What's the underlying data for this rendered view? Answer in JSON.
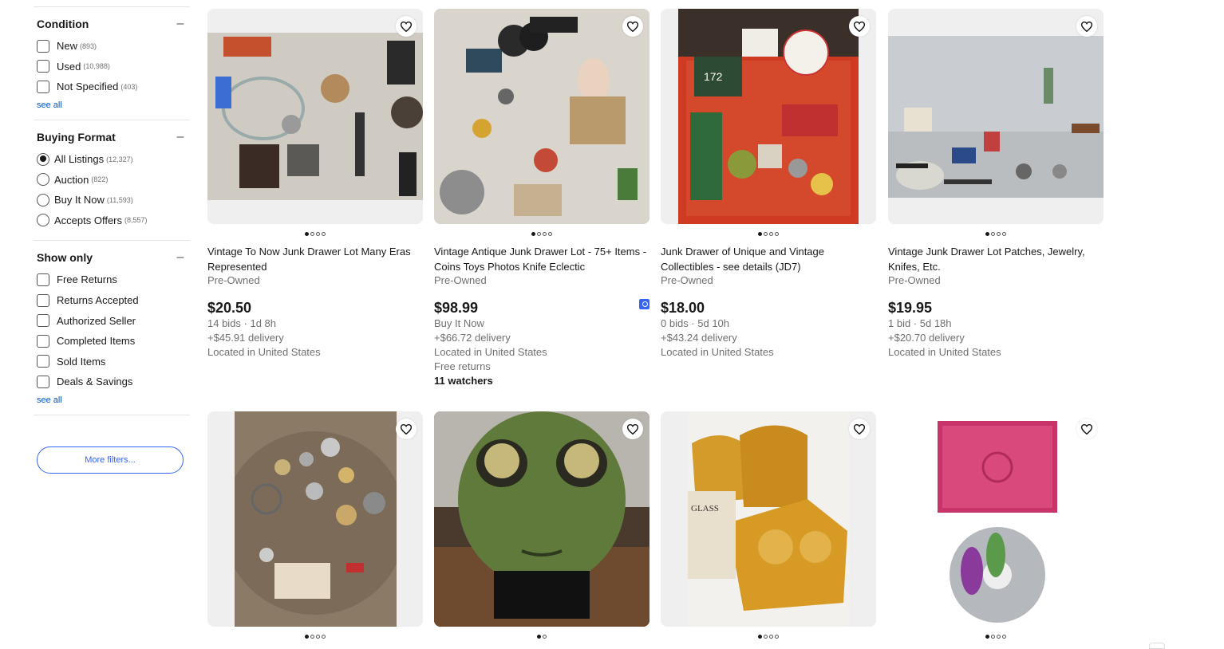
{
  "sidebar": {
    "condition": {
      "title": "Condition",
      "options": [
        {
          "label": "New",
          "count": "(893)"
        },
        {
          "label": "Used",
          "count": "(10,988)"
        },
        {
          "label": "Not Specified",
          "count": "(403)"
        }
      ],
      "see_all": "see all"
    },
    "buying_format": {
      "title": "Buying Format",
      "options": [
        {
          "label": "All Listings",
          "count": "(12,327)",
          "selected": true
        },
        {
          "label": "Auction",
          "count": "(822)"
        },
        {
          "label": "Buy It Now",
          "count": "(11,593)"
        },
        {
          "label": "Accepts Offers",
          "count": "(8,557)"
        }
      ]
    },
    "show_only": {
      "title": "Show only",
      "options": [
        "Free Returns",
        "Returns Accepted",
        "Authorized Seller",
        "Completed Items",
        "Sold Items",
        "Deals & Savings"
      ],
      "see_all": "see all"
    },
    "more_filters": "More filters..."
  },
  "listings": [
    {
      "title": "Vintage To Now Junk Drawer Lot Many Eras Represented",
      "condition": "Pre-Owned",
      "price": "$20.50",
      "line1": "14 bids · 1d 8h",
      "line2": "+$45.91 delivery",
      "line3": "Located in United States"
    },
    {
      "title": "Vintage Antique Junk Drawer Lot - 75+ Items - Coins Toys Photos Knife Eclectic",
      "condition": "Pre-Owned",
      "price": "$98.99",
      "line1": "Buy It Now",
      "line2": "+$66.72 delivery",
      "line3": "Located in United States",
      "line4": "Free returns",
      "watchers": "11 watchers"
    },
    {
      "title": "Junk Drawer of Unique and Vintage Collectibles - see details (JD7)",
      "condition": "Pre-Owned",
      "price": "$18.00",
      "line1": "0 bids · 5d 10h",
      "line2": "+$43.24 delivery",
      "line3": "Located in United States"
    },
    {
      "title": "Vintage Junk Drawer Lot Patches, Jewelry, Knifes, Etc.",
      "condition": "Pre-Owned",
      "price": "$19.95",
      "line1": "1 bid · 5d 18h",
      "line2": "+$20.70 delivery",
      "line3": "Located in United States"
    }
  ],
  "colors": {
    "link": "#0654ba",
    "accent": "#3665f3",
    "muted": "#707070",
    "image_bg": "#efefef"
  },
  "icons": {
    "wishlist": "heart-outline-icon",
    "collapse": "minus-icon"
  }
}
